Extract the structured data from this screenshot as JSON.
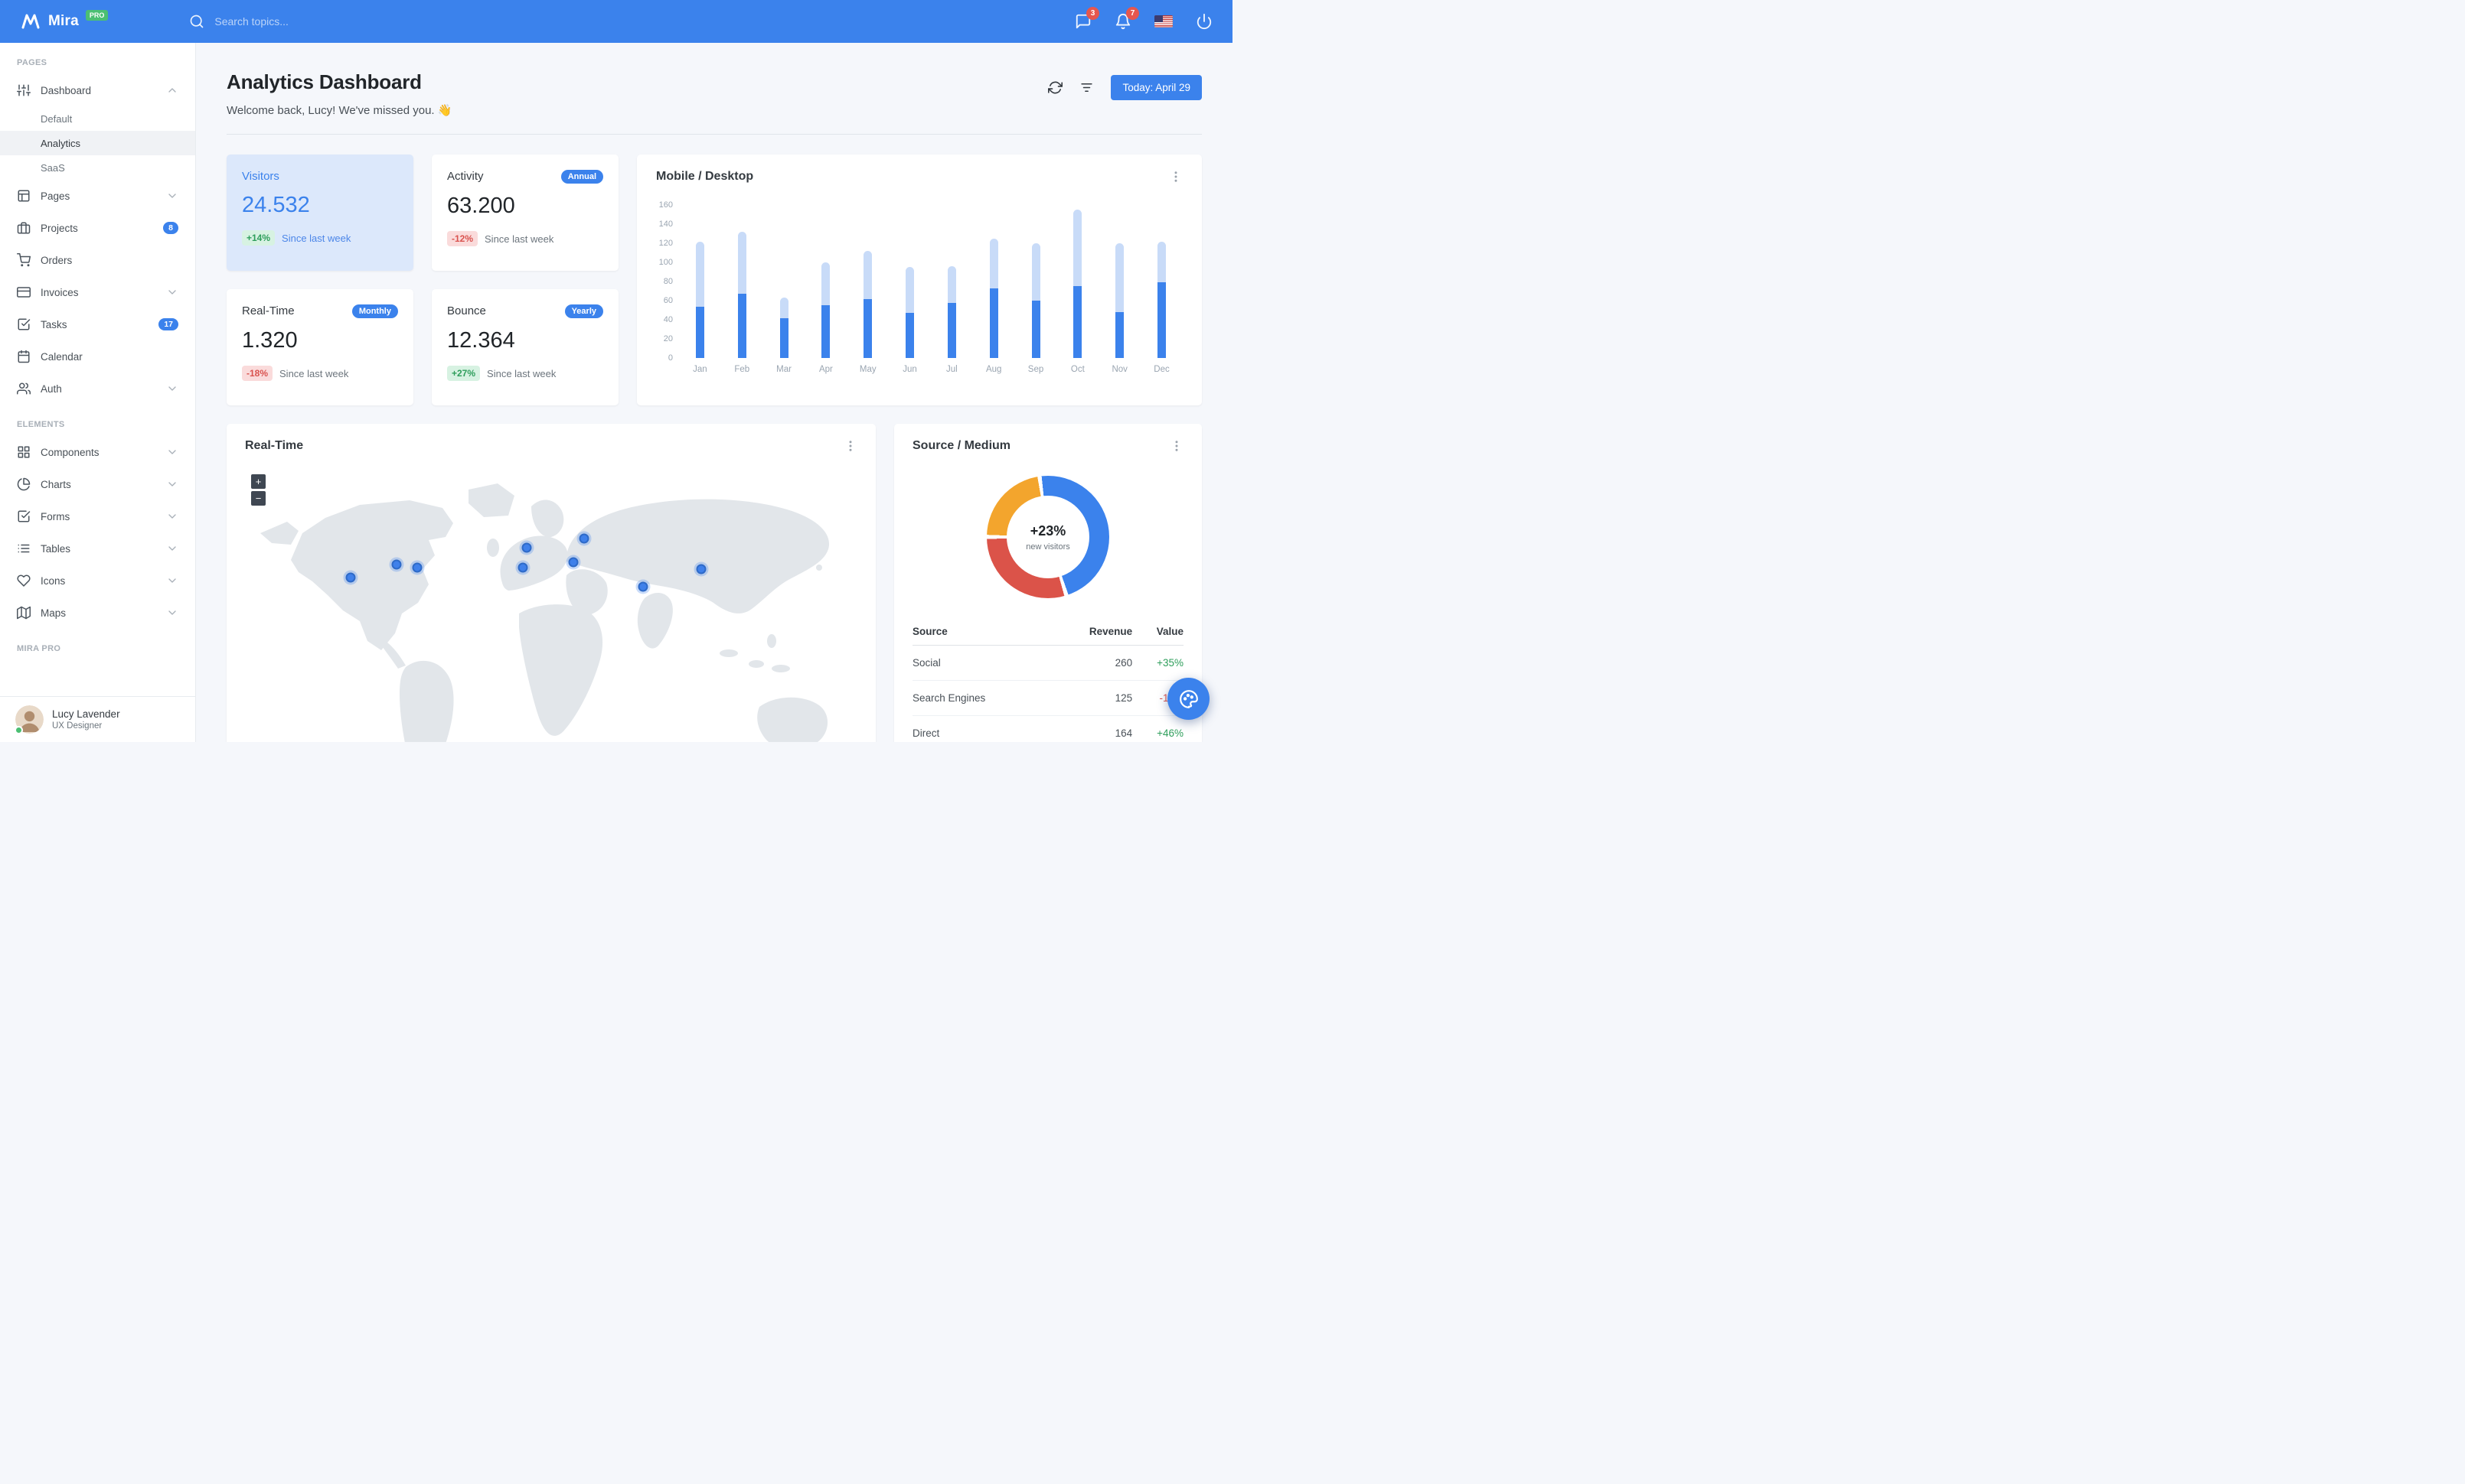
{
  "navbar": {
    "brand": "Mira",
    "brand_badge": "PRO",
    "search_placeholder": "Search topics...",
    "messages_badge": "3",
    "alerts_badge": "7"
  },
  "sidebar": {
    "sections": [
      {
        "label": "PAGES",
        "items": [
          {
            "label": "Dashboard",
            "icon": "sliders",
            "chevron": "up",
            "active": true,
            "children": [
              {
                "label": "Default",
                "active": false
              },
              {
                "label": "Analytics",
                "active": true
              },
              {
                "label": "SaaS",
                "active": false
              }
            ]
          },
          {
            "label": "Pages",
            "icon": "layout",
            "chevron": "down"
          },
          {
            "label": "Projects",
            "icon": "briefcase",
            "badge": "8"
          },
          {
            "label": "Orders",
            "icon": "shopping-cart"
          },
          {
            "label": "Invoices",
            "icon": "credit-card",
            "chevron": "down"
          },
          {
            "label": "Tasks",
            "icon": "check-square",
            "badge": "17"
          },
          {
            "label": "Calendar",
            "icon": "calendar"
          },
          {
            "label": "Auth",
            "icon": "users",
            "chevron": "down"
          }
        ]
      },
      {
        "label": "ELEMENTS",
        "items": [
          {
            "label": "Components",
            "icon": "grid",
            "chevron": "down"
          },
          {
            "label": "Charts",
            "icon": "pie-chart",
            "chevron": "down"
          },
          {
            "label": "Forms",
            "icon": "check-square",
            "chevron": "down"
          },
          {
            "label": "Tables",
            "icon": "list",
            "chevron": "down"
          },
          {
            "label": "Icons",
            "icon": "heart",
            "chevron": "down"
          },
          {
            "label": "Maps",
            "icon": "map",
            "chevron": "down"
          }
        ]
      },
      {
        "label": "MIRA PRO",
        "items": []
      }
    ],
    "user": {
      "name": "Lucy Lavender",
      "role": "UX Designer",
      "status": "online"
    }
  },
  "header": {
    "title": "Analytics Dashboard",
    "subtitle": "Welcome back, Lucy! We've missed you. 👋",
    "date_button": "Today: April 29"
  },
  "stats": [
    {
      "title": "Visitors",
      "value": "24.532",
      "delta": "+14%",
      "delta_dir": "up",
      "note": "Since last week",
      "highlight": true
    },
    {
      "title": "Activity",
      "value": "63.200",
      "delta": "-12%",
      "delta_dir": "down",
      "note": "Since last week",
      "badge": "Annual"
    },
    {
      "title": "Real-Time",
      "value": "1.320",
      "delta": "-18%",
      "delta_dir": "down",
      "note": "Since last week",
      "badge": "Monthly"
    },
    {
      "title": "Bounce",
      "value": "12.364",
      "delta": "+27%",
      "delta_dir": "up",
      "note": "Since last week",
      "badge": "Yearly"
    }
  ],
  "chart_data": [
    {
      "type": "bar",
      "stacked": true,
      "title": "Mobile / Desktop",
      "categories": [
        "Jan",
        "Feb",
        "Mar",
        "Apr",
        "May",
        "Jun",
        "Jul",
        "Aug",
        "Sep",
        "Oct",
        "Nov",
        "Dec"
      ],
      "series": [
        {
          "name": "Mobile",
          "color": "#3B82EC",
          "values": [
            54,
            67,
            42,
            55,
            62,
            47,
            58,
            73,
            60,
            75,
            48,
            79
          ]
        },
        {
          "name": "Desktop",
          "color": "#C8DBF8",
          "values": [
            68,
            65,
            21,
            45,
            50,
            48,
            38,
            52,
            60,
            80,
            72,
            43
          ]
        }
      ],
      "ylim": [
        0,
        160
      ],
      "yticks": [
        0,
        20,
        40,
        60,
        80,
        100,
        120,
        140,
        160
      ],
      "legend": false,
      "grid": false
    },
    {
      "type": "donut",
      "title": "Source / Medium",
      "center_value": "+23%",
      "center_label": "new visitors",
      "segments": [
        {
          "name": "Social",
          "value": 260,
          "color": "#3B82EC"
        },
        {
          "name": "Direct",
          "value": 164,
          "color": "#DB5349"
        },
        {
          "name": "Search Engines",
          "value": 125,
          "color": "#F3A52D"
        }
      ]
    }
  ],
  "realtime_map": {
    "title": "Real-Time",
    "zoom_in": "+",
    "zoom_out": "−",
    "markers": [
      [
        138,
        153
      ],
      [
        198,
        136
      ],
      [
        225,
        140
      ],
      [
        363,
        140
      ],
      [
        368,
        114
      ],
      [
        443,
        102
      ],
      [
        429,
        133
      ],
      [
        520,
        165
      ],
      [
        596,
        142
      ]
    ]
  },
  "source_card": {
    "title": "Source / Medium",
    "table": {
      "headers": [
        "Source",
        "Revenue",
        "Value"
      ],
      "rows": [
        {
          "source": "Social",
          "revenue": "260",
          "value": "+35%",
          "dir": "up"
        },
        {
          "source": "Search Engines",
          "revenue": "125",
          "value": "-12%",
          "dir": "down"
        },
        {
          "source": "Direct",
          "revenue": "164",
          "value": "+46%",
          "dir": "up"
        }
      ]
    }
  },
  "colors": {
    "primary": "#3B82EC",
    "primary_light": "#C8DBF8",
    "success": "#4BBF73",
    "danger": "#D9534F",
    "warning": "#F3A52D",
    "navbar": "#3B82EC",
    "background": "#F5F7FB"
  }
}
